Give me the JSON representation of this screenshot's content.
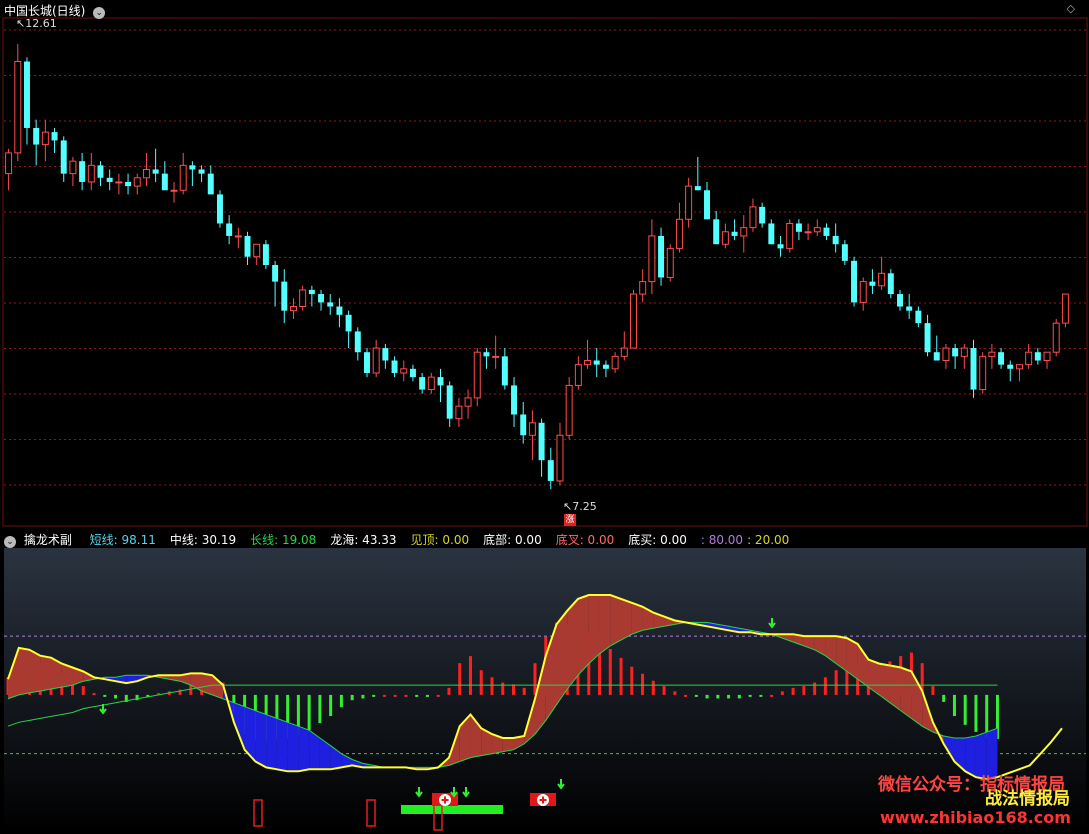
{
  "main_panel": {
    "title": "中国长城(日线)",
    "high_label": "12.61",
    "low_label": "7.25",
    "marker": "涨"
  },
  "sub_panel": {
    "name": "擒龙术副",
    "legend": [
      {
        "label": "短线:",
        "value": "98.11",
        "color": "#5ad2e6"
      },
      {
        "label": "中线:",
        "value": "30.19",
        "color": "#ffffff"
      },
      {
        "label": "长线:",
        "value": "19.08",
        "color": "#29d34a"
      },
      {
        "label": "龙海:",
        "value": "43.33",
        "color": "#ffffff"
      },
      {
        "label": "见顶:",
        "value": "0.00",
        "color": "#d6d629"
      },
      {
        "label": "底部:",
        "value": "0.00",
        "color": "#ffffff"
      },
      {
        "label": "底叉:",
        "value": "0.00",
        "color": "#ff6a6a"
      },
      {
        "label": "底买:",
        "value": "0.00",
        "color": "#ffffff"
      }
    ],
    "levels_text": [
      ": 80.00",
      ": 20.00"
    ],
    "levels_colors": [
      "#b07fd6",
      "#d6d629"
    ]
  },
  "watermarks": {
    "wechat": "微信公众号：指标情报局",
    "tactics": "战法情报局",
    "site": "www.zhibiao168.com"
  },
  "colors": {
    "up": "#ff4d4d",
    "down": "#54ffff",
    "grid": "#8a1a1a",
    "yellow": "#ffff33",
    "green": "#33dd33",
    "red_fill": "#a83a32",
    "blue_fill": "#1f1fe0"
  },
  "chart_data": [
    {
      "type": "candlestick",
      "title": "中国长城(日线)",
      "ylim": [
        7.0,
        12.9
      ],
      "annotations": [
        {
          "text": "12.61",
          "value": 12.61
        },
        {
          "text": "7.25",
          "value": 7.25
        }
      ],
      "candles": [
        [
          11.05,
          11.35,
          10.85,
          11.3
        ],
        [
          11.3,
          12.61,
          11.2,
          12.4
        ],
        [
          12.4,
          12.45,
          11.4,
          11.6
        ],
        [
          11.6,
          11.7,
          11.15,
          11.4
        ],
        [
          11.4,
          11.7,
          11.2,
          11.55
        ],
        [
          11.55,
          11.6,
          11.3,
          11.45
        ],
        [
          11.45,
          11.5,
          10.95,
          11.05
        ],
        [
          11.05,
          11.25,
          10.9,
          11.2
        ],
        [
          11.2,
          11.3,
          10.85,
          10.95
        ],
        [
          10.95,
          11.3,
          10.85,
          11.15
        ],
        [
          11.15,
          11.2,
          10.9,
          11.0
        ],
        [
          11.0,
          11.1,
          10.85,
          10.95
        ],
        [
          10.95,
          11.05,
          10.8,
          10.95
        ],
        [
          10.95,
          11.05,
          10.8,
          10.9
        ],
        [
          10.9,
          11.05,
          10.8,
          11.0
        ],
        [
          11.0,
          11.3,
          10.9,
          11.1
        ],
        [
          11.1,
          11.35,
          10.95,
          11.05
        ],
        [
          11.05,
          11.2,
          10.85,
          10.85
        ],
        [
          10.85,
          10.95,
          10.7,
          10.85
        ],
        [
          10.85,
          11.3,
          10.8,
          11.15
        ],
        [
          11.15,
          11.2,
          10.9,
          11.1
        ],
        [
          11.1,
          11.15,
          10.95,
          11.05
        ],
        [
          11.05,
          11.15,
          10.8,
          10.8
        ],
        [
          10.8,
          10.85,
          10.4,
          10.45
        ],
        [
          10.45,
          10.55,
          10.2,
          10.3
        ],
        [
          10.3,
          10.4,
          10.15,
          10.3
        ],
        [
          10.3,
          10.35,
          9.95,
          10.05
        ],
        [
          10.05,
          10.2,
          9.95,
          10.2
        ],
        [
          10.2,
          10.25,
          9.9,
          9.95
        ],
        [
          9.95,
          10.0,
          9.45,
          9.75
        ],
        [
          9.75,
          9.9,
          9.25,
          9.4
        ],
        [
          9.4,
          9.55,
          9.3,
          9.45
        ],
        [
          9.45,
          9.7,
          9.4,
          9.65
        ],
        [
          9.65,
          9.7,
          9.45,
          9.6
        ],
        [
          9.6,
          9.65,
          9.4,
          9.5
        ],
        [
          9.5,
          9.6,
          9.35,
          9.45
        ],
        [
          9.45,
          9.55,
          9.2,
          9.35
        ],
        [
          9.35,
          9.4,
          8.95,
          9.15
        ],
        [
          9.15,
          9.2,
          8.8,
          8.9
        ],
        [
          8.9,
          8.95,
          8.6,
          8.65
        ],
        [
          8.65,
          9.05,
          8.6,
          8.95
        ],
        [
          8.95,
          9.0,
          8.7,
          8.8
        ],
        [
          8.8,
          8.85,
          8.6,
          8.65
        ],
        [
          8.65,
          8.8,
          8.55,
          8.7
        ],
        [
          8.7,
          8.75,
          8.55,
          8.6
        ],
        [
          8.6,
          8.65,
          8.4,
          8.45
        ],
        [
          8.45,
          8.65,
          8.4,
          8.6
        ],
        [
          8.6,
          8.7,
          8.3,
          8.5
        ],
        [
          8.5,
          8.55,
          8.0,
          8.1
        ],
        [
          8.1,
          8.35,
          8.0,
          8.25
        ],
        [
          8.25,
          8.45,
          8.1,
          8.35
        ],
        [
          8.35,
          8.95,
          8.25,
          8.9
        ],
        [
          8.9,
          8.95,
          8.7,
          8.85
        ],
        [
          8.85,
          9.1,
          8.7,
          8.85
        ],
        [
          8.85,
          8.95,
          8.45,
          8.5
        ],
        [
          8.5,
          8.6,
          8.0,
          8.15
        ],
        [
          8.15,
          8.3,
          7.8,
          7.9
        ],
        [
          7.9,
          8.2,
          7.6,
          8.05
        ],
        [
          8.05,
          8.1,
          7.4,
          7.6
        ],
        [
          7.6,
          7.75,
          7.25,
          7.35
        ],
        [
          7.35,
          8.05,
          7.3,
          7.9
        ],
        [
          7.9,
          8.6,
          7.85,
          8.5
        ],
        [
          8.5,
          8.85,
          8.45,
          8.75
        ],
        [
          8.75,
          9.05,
          8.7,
          8.8
        ],
        [
          8.8,
          8.95,
          8.6,
          8.75
        ],
        [
          8.75,
          8.8,
          8.6,
          8.7
        ],
        [
          8.7,
          8.9,
          8.65,
          8.85
        ],
        [
          8.85,
          9.15,
          8.8,
          8.95
        ],
        [
          8.95,
          9.65,
          8.95,
          9.6
        ],
        [
          9.6,
          9.9,
          9.5,
          9.75
        ],
        [
          9.75,
          10.5,
          9.6,
          10.3
        ],
        [
          10.3,
          10.4,
          9.7,
          9.8
        ],
        [
          9.8,
          10.2,
          9.75,
          10.15
        ],
        [
          10.15,
          10.7,
          10.1,
          10.5
        ],
        [
          10.5,
          11.0,
          10.4,
          10.9
        ],
        [
          10.9,
          11.25,
          10.85,
          10.85
        ],
        [
          10.85,
          10.95,
          10.5,
          10.5
        ],
        [
          10.5,
          10.6,
          10.3,
          10.2
        ],
        [
          10.2,
          10.45,
          10.15,
          10.35
        ],
        [
          10.35,
          10.5,
          10.25,
          10.3
        ],
        [
          10.3,
          10.55,
          10.1,
          10.4
        ],
        [
          10.4,
          10.75,
          10.35,
          10.65
        ],
        [
          10.65,
          10.7,
          10.4,
          10.45
        ],
        [
          10.45,
          10.5,
          10.2,
          10.2
        ],
        [
          10.2,
          10.3,
          10.05,
          10.15
        ],
        [
          10.15,
          10.5,
          10.1,
          10.45
        ],
        [
          10.45,
          10.5,
          10.25,
          10.35
        ],
        [
          10.35,
          10.45,
          10.25,
          10.35
        ],
        [
          10.35,
          10.5,
          10.3,
          10.4
        ],
        [
          10.4,
          10.45,
          10.25,
          10.3
        ],
        [
          10.3,
          10.45,
          10.1,
          10.2
        ],
        [
          10.2,
          10.25,
          9.95,
          10.0
        ],
        [
          10.0,
          10.05,
          9.45,
          9.5
        ],
        [
          9.5,
          9.8,
          9.4,
          9.75
        ],
        [
          9.75,
          9.9,
          9.6,
          9.7
        ],
        [
          9.7,
          10.05,
          9.65,
          9.85
        ],
        [
          9.85,
          9.9,
          9.55,
          9.6
        ],
        [
          9.6,
          9.65,
          9.4,
          9.45
        ],
        [
          9.45,
          9.6,
          9.3,
          9.4
        ],
        [
          9.4,
          9.45,
          9.2,
          9.25
        ],
        [
          9.25,
          9.35,
          8.85,
          8.9
        ],
        [
          8.9,
          9.1,
          8.8,
          8.8
        ],
        [
          8.8,
          9.0,
          8.7,
          8.95
        ],
        [
          8.95,
          9.0,
          8.7,
          8.85
        ],
        [
          8.85,
          9.0,
          8.7,
          8.95
        ],
        [
          8.95,
          9.05,
          8.35,
          8.45
        ],
        [
          8.45,
          8.9,
          8.4,
          8.85
        ],
        [
          8.85,
          9.0,
          8.7,
          8.9
        ],
        [
          8.9,
          8.95,
          8.7,
          8.75
        ],
        [
          8.75,
          8.8,
          8.55,
          8.7
        ],
        [
          8.7,
          8.75,
          8.55,
          8.75
        ],
        [
          8.75,
          9.0,
          8.7,
          8.9
        ],
        [
          8.9,
          8.95,
          8.75,
          8.8
        ],
        [
          8.8,
          8.9,
          8.7,
          8.9
        ],
        [
          8.9,
          9.3,
          8.85,
          9.25
        ],
        [
          9.25,
          9.6,
          9.2,
          9.6
        ]
      ]
    },
    {
      "type": "indicator",
      "title": "擒龙术副",
      "ylim": [
        -20,
        125
      ],
      "levels": [
        80,
        20
      ],
      "series": [
        {
          "name": "短线",
          "values": [
            58,
            74,
            73,
            70,
            69,
            66,
            64,
            62,
            59,
            58,
            57,
            56,
            57,
            59,
            60,
            60,
            60,
            61,
            61,
            60,
            55,
            36,
            22,
            16,
            13,
            12,
            11,
            11,
            12,
            12,
            12,
            13,
            14,
            13,
            13,
            13,
            13,
            13,
            12,
            12,
            13,
            18,
            34,
            40,
            33,
            30,
            28,
            28,
            29,
            48,
            70,
            86,
            93,
            99,
            101,
            101,
            101,
            99,
            97,
            95,
            92,
            90,
            88,
            87,
            86,
            85,
            84,
            83,
            82,
            82,
            81,
            81,
            81,
            81,
            80,
            80,
            80,
            80,
            79,
            76,
            68,
            66,
            65,
            64,
            62,
            52,
            36,
            25,
            16,
            11,
            8,
            7,
            8,
            10,
            12,
            14,
            20,
            26,
            33
          ]
        },
        {
          "name": "中线",
          "values": [
            48,
            50,
            51,
            52,
            53,
            54,
            55,
            57,
            58,
            59,
            59,
            60,
            60,
            60,
            59,
            58,
            57,
            55,
            52,
            50,
            48,
            46,
            44,
            42,
            40,
            38,
            36,
            34,
            32,
            28,
            24,
            20,
            17,
            15,
            14,
            13,
            13,
            13,
            13,
            13,
            13,
            14,
            16,
            18,
            19,
            20,
            21,
            22,
            25,
            30,
            37,
            45,
            53,
            60,
            66,
            71,
            75,
            78,
            81,
            83,
            84,
            85,
            86,
            87,
            87,
            87,
            86,
            85,
            84,
            83,
            82,
            81,
            79,
            77,
            75,
            73,
            70,
            66,
            62,
            58,
            54,
            50,
            46,
            42,
            38,
            34,
            31,
            29,
            28,
            28,
            29,
            31,
            33
          ]
        },
        {
          "name": "长线",
          "values": [
            34,
            36,
            37,
            38,
            39,
            40,
            41,
            43,
            44,
            45,
            46,
            47,
            48,
            49,
            50,
            51,
            52,
            53,
            54,
            55,
            55,
            55,
            55,
            55,
            55,
            55,
            55,
            55,
            55,
            55,
            55,
            55,
            55,
            55,
            55,
            55,
            55,
            55,
            55,
            55,
            55,
            55,
            55,
            55,
            55,
            55,
            55,
            55,
            55,
            55,
            55,
            55,
            55,
            55,
            55,
            55,
            55,
            55,
            55,
            55,
            55,
            55,
            55,
            55,
            55,
            55,
            55,
            55,
            55,
            55,
            55,
            55,
            55,
            55,
            55,
            55,
            55,
            55,
            55,
            55,
            55,
            55,
            55,
            55,
            55,
            55,
            55,
            55,
            55,
            55,
            55,
            55,
            55
          ]
        }
      ]
    }
  ]
}
